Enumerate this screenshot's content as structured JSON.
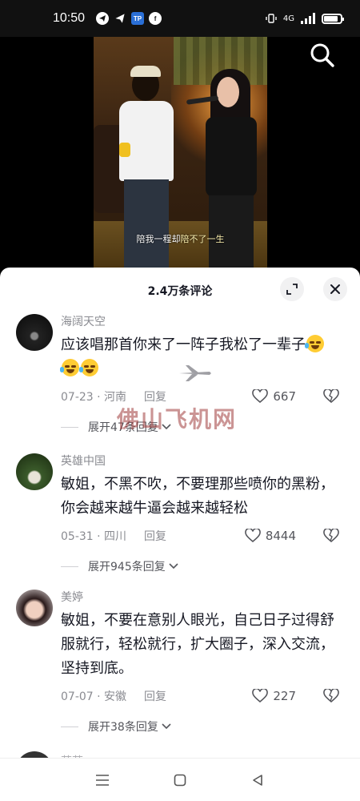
{
  "status_bar": {
    "time": "10:50",
    "network": "4G",
    "battery_level": 0.85,
    "apps": [
      "telegram",
      "telegram",
      "TP",
      "facebook"
    ],
    "tp_label": "TP",
    "fb_label": "f"
  },
  "video": {
    "subtitle_part1": "陪我一程却",
    "subtitle_part2": "陪不了一生"
  },
  "comments_panel": {
    "title": "2.4万条评论",
    "comments": [
      {
        "username": "海阔天空",
        "text": "应该唱那首你来了一阵子我松了一辈子",
        "date_location": "07-23 · 河南",
        "reply_label": "回复",
        "likes": "667",
        "expand_label": "展开47条回复"
      },
      {
        "username": "英雄中国",
        "text": "敏姐，不黑不吹，不要理那些喷你的黑粉，你会越来越牛逼会越来越轻松",
        "date_location": "05-31 · 四川",
        "reply_label": "回复",
        "likes": "8444",
        "expand_label": "展开945条回复"
      },
      {
        "username": "美婷",
        "text": "敏姐，不要在意别人眼光，自己日子过得舒服就行，轻松就行，扩大圈子，深入交流，坚持到底。",
        "date_location": "07-07 · 安徽",
        "reply_label": "回复",
        "likes": "227",
        "expand_label": "展开38条回复"
      }
    ],
    "peek_username": "若若"
  },
  "watermark": "佛山飞机网",
  "colors": {
    "sheet_bg": "#ffffff",
    "text_primary": "#161823",
    "text_secondary": "#8a8b91"
  }
}
